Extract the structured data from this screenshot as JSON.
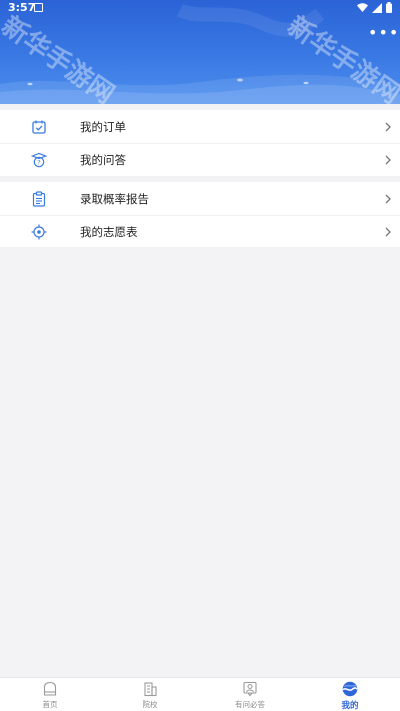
{
  "status_bar": {
    "time": "3:57"
  },
  "header": {
    "watermark": "新华手游网",
    "more_label": "•••"
  },
  "menu_group_1": [
    {
      "label": "我的订单",
      "icon": "order-check-icon"
    },
    {
      "label": "我的问答",
      "icon": "question-icon"
    }
  ],
  "menu_group_2": [
    {
      "label": "录取概率报告",
      "icon": "clipboard-icon"
    },
    {
      "label": "我的志愿表",
      "icon": "target-icon"
    }
  ],
  "bottom_nav": {
    "items": [
      {
        "label": "首页",
        "icon": "home-icon",
        "active": false
      },
      {
        "label": "院校",
        "icon": "school-icon",
        "active": false
      },
      {
        "label": "有问必答",
        "icon": "qa-icon",
        "active": false
      },
      {
        "label": "我的",
        "icon": "profile-icon",
        "active": true
      }
    ]
  },
  "colors": {
    "accent": "#2f66d8",
    "header_top": "#2b63d6",
    "header_bottom": "#4d8fee",
    "icon_blue": "#3b7be0",
    "background": "#f3f3f5"
  }
}
